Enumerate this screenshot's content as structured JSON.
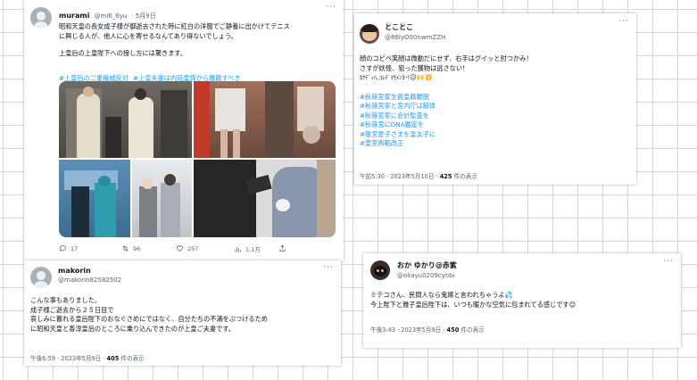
{
  "tweet1": {
    "name": "murami",
    "handle": "@mi6_6yu",
    "date": "· 5月9日",
    "line1": "昭和天皇の長女成子様が御逝去された時に紅白の洋服でご静養に出かけてテニス",
    "line2": "に興じる人が、他人に心を寄せるなんてあり得ないでしょう。",
    "line3": "上皇后の上皇陛下への接し方には驚きます。",
    "tag1": "#上皇后の二重権威反対",
    "tag2": "#上皇夫妻は内廷皇族から離籍すべき",
    "actions": {
      "replies": "17",
      "retweets": "96",
      "likes": "257",
      "views": "1.1万"
    }
  },
  "tweet2": {
    "name": "makorin",
    "handle": "@makorin82582502",
    "lines": [
      "こんな事もありました。",
      "成子様ご逝去から２５日目で",
      "哀しみに暮れる皇后陛下のおなぐさめにではなく、自分たちの不満をぶつけるため",
      "に昭和天皇と香淳皇后のところに乗り込んできたのが上皇ご夫妻です。"
    ],
    "time": "午後6:59 · 2023年5月9日 · ",
    "views_count": "405",
    "views_label": " 件の表示"
  },
  "tweet3": {
    "name": "とことこ",
    "handle": "@86lyO00nwmZZH",
    "line1": "顔のコピペ笑顔は微動だにせず、右手はグイッと肘つかみ！",
    "line2": "さすが妖怪、狙った獲物は逃さない！",
    "line3": "ｶｸﾃﾞｨﾊ､ｺﾚﾃﾞﾏﾓﾒﾝﾖｰ!",
    "emoji": "😑🙌💥",
    "tags": [
      "#秋篠宮家全員皇籍離脱",
      "#秋篠宮家と宮内庁は解体",
      "#秋篠宮家に会計監査を",
      "#秋篠宮にDNA鑑定を",
      "#敬宮愛子さまを皇太子に",
      "#皇室典範改正"
    ],
    "time": "午前5:30 · 2023年5月10日 · ",
    "views_count": "425",
    "views_label": " 件の表示"
  },
  "tweet4": {
    "name": "おか ゆかり@赤紫",
    "handle": "@okayu0209cyobi",
    "line1": "ミテコさん、民間人なら鬼嫁と言われちゃうよ💦",
    "line2": "今上陛下と雅子皇后陛下は、いつも暖かな空気に包まれてる感じです😊",
    "time": "午後3:43 · 2023年5月9日 · ",
    "views_count": "450",
    "views_label": " 件の表示"
  },
  "colors": {
    "link": "#1d9bf0",
    "muted": "#536471",
    "text": "#0f1419"
  }
}
